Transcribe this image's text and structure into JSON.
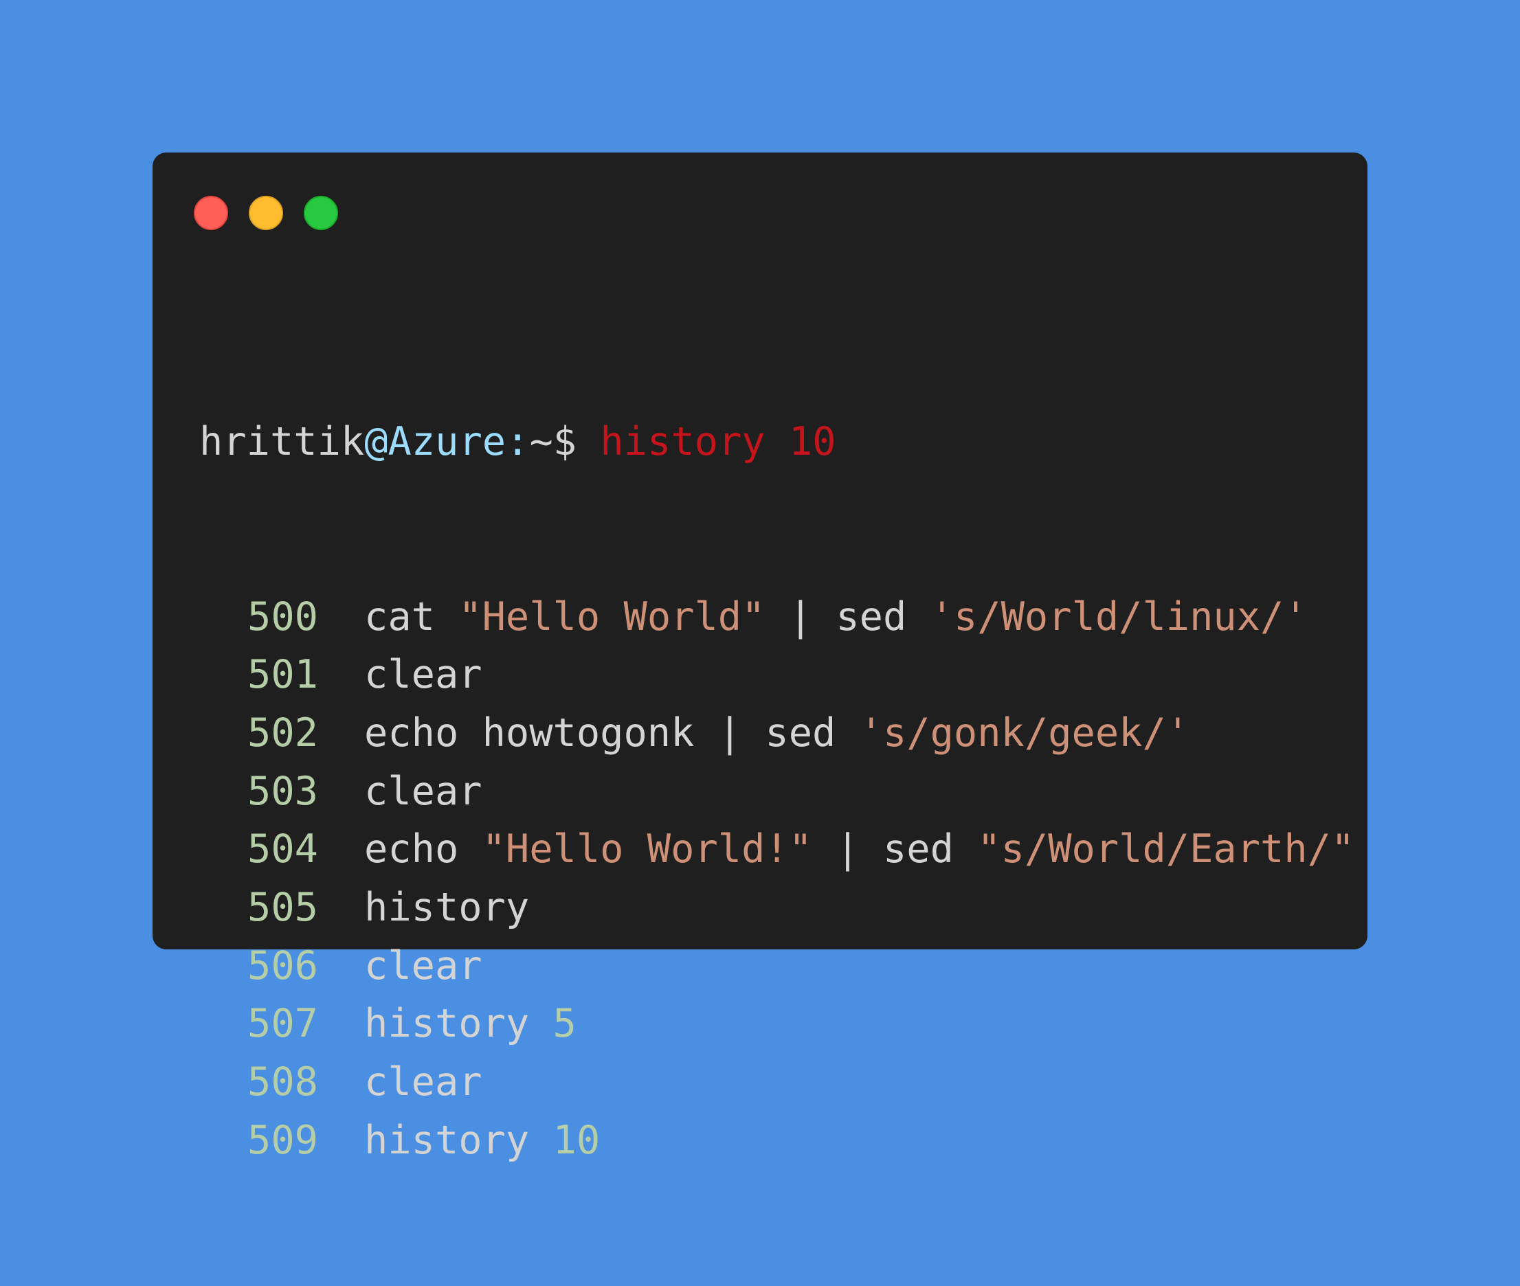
{
  "colors": {
    "background": "#4a8fe2",
    "window": "#1f1f1f",
    "text": "#d4d4d4",
    "host": "#9cdcfe",
    "command": "#c5141b",
    "string": "#ce9178",
    "number": "#b5cea8",
    "close_button": "#ff5f57",
    "minimize_button": "#febc2e",
    "maximize_button": "#28c840"
  },
  "window_controls": [
    {
      "name": "close",
      "icon": "red-circle"
    },
    {
      "name": "minimize",
      "icon": "yellow-circle"
    },
    {
      "name": "maximize",
      "icon": "green-circle"
    }
  ],
  "prompt": {
    "user": "hrittik",
    "host": "@Azure:",
    "path_symbol": "~$",
    "command": "history 10"
  },
  "history": [
    {
      "number": "500",
      "segments": [
        {
          "text": "cat ",
          "kind": "text"
        },
        {
          "text": "\"Hello World\"",
          "kind": "string"
        },
        {
          "text": " | sed ",
          "kind": "text"
        },
        {
          "text": "'s/World/linux/'",
          "kind": "string"
        }
      ]
    },
    {
      "number": "501",
      "segments": [
        {
          "text": "clear",
          "kind": "text"
        }
      ]
    },
    {
      "number": "502",
      "segments": [
        {
          "text": "echo howtogonk | sed ",
          "kind": "text"
        },
        {
          "text": "'s/gonk/geek/'",
          "kind": "string"
        }
      ]
    },
    {
      "number": "503",
      "segments": [
        {
          "text": "clear",
          "kind": "text"
        }
      ]
    },
    {
      "number": "504",
      "segments": [
        {
          "text": "echo ",
          "kind": "text"
        },
        {
          "text": "\"Hello World!\"",
          "kind": "string"
        },
        {
          "text": " | sed ",
          "kind": "text"
        },
        {
          "text": "\"s/World/Earth/\"",
          "kind": "string"
        }
      ]
    },
    {
      "number": "505",
      "segments": [
        {
          "text": "history",
          "kind": "text"
        }
      ]
    },
    {
      "number": "506",
      "segments": [
        {
          "text": "clear",
          "kind": "text"
        }
      ]
    },
    {
      "number": "507",
      "segments": [
        {
          "text": "history ",
          "kind": "text"
        },
        {
          "text": "5",
          "kind": "number"
        }
      ]
    },
    {
      "number": "508",
      "segments": [
        {
          "text": "clear",
          "kind": "text"
        }
      ]
    },
    {
      "number": "509",
      "segments": [
        {
          "text": "history ",
          "kind": "text"
        },
        {
          "text": "10",
          "kind": "number"
        }
      ]
    }
  ]
}
